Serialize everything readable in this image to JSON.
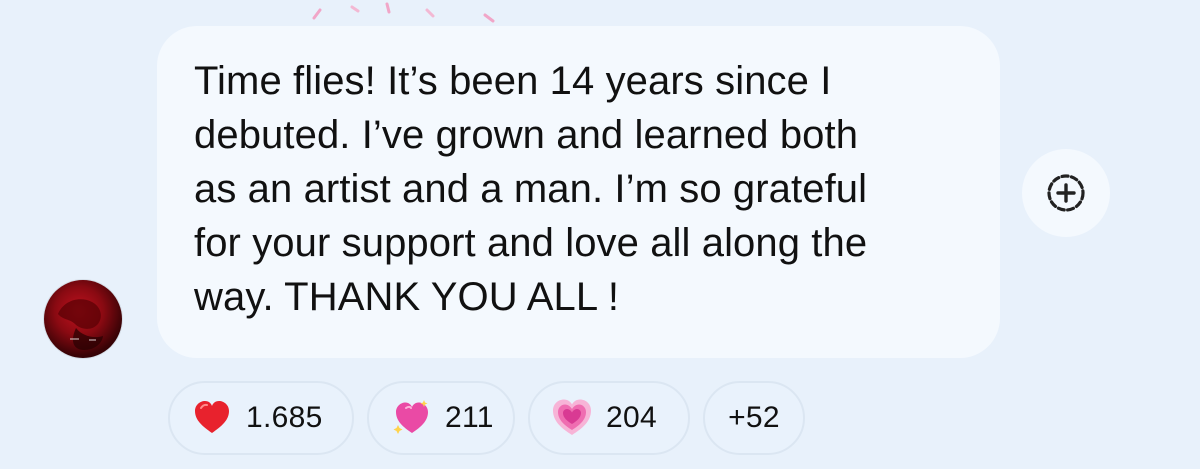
{
  "message": {
    "text": "Time flies! It’s been 14 years since I\ndebuted. I’ve grown and learned both\nas an artist and a man. I’m so grateful\nfor your support and love all along the\nway. THANK YOU ALL !"
  },
  "avatar": {
    "icon": "profile-photo"
  },
  "add_reaction": {
    "icon": "add-reaction-icon"
  },
  "reactions": [
    {
      "emoji": "red-heart",
      "count": "1.685"
    },
    {
      "emoji": "sparkling-heart",
      "count": "211"
    },
    {
      "emoji": "growing-heart",
      "count": "204"
    },
    {
      "emoji": "",
      "count": "+52"
    }
  ],
  "colors": {
    "background": "#e8f1fb",
    "bubble": "#f4f9fe",
    "pill_border": "#dbe6f2",
    "text": "#111111"
  }
}
